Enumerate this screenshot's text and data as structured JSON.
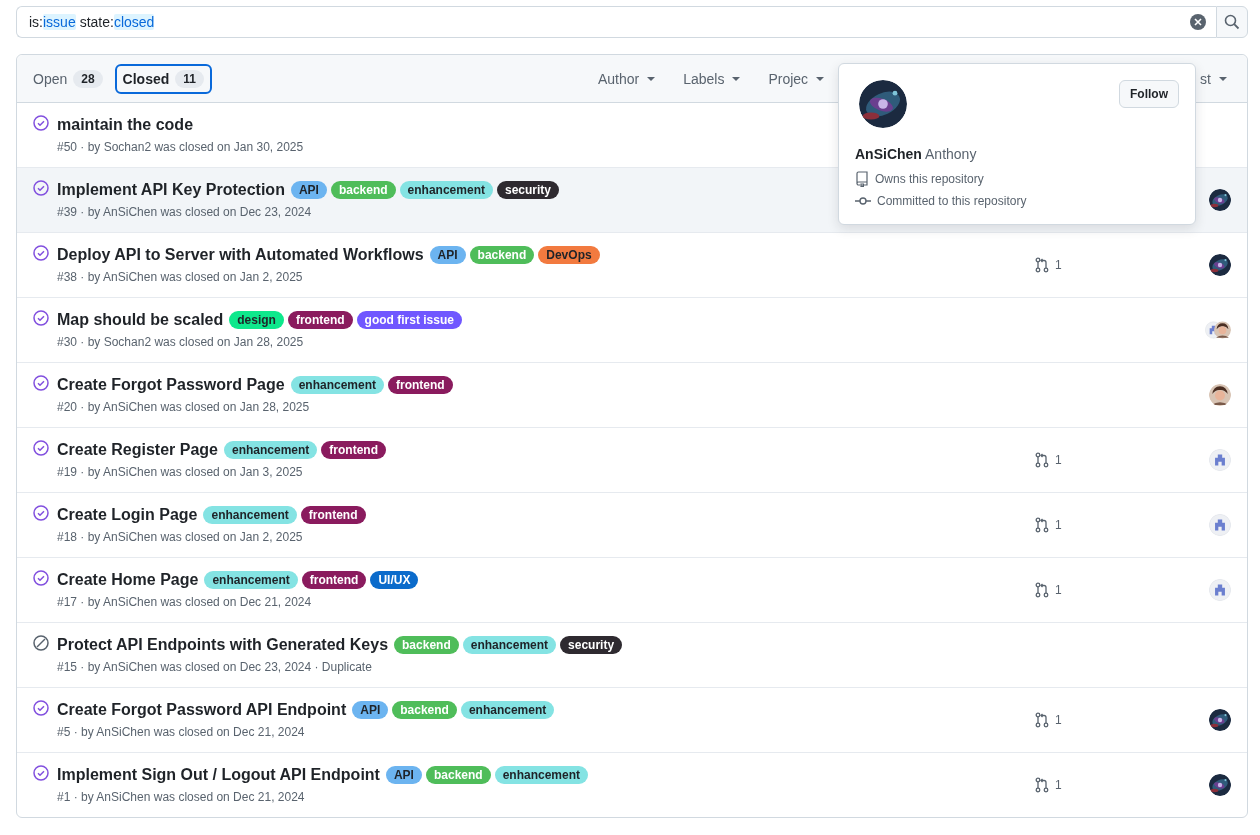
{
  "search": {
    "tokens": [
      {
        "text": "is:",
        "kind": "key"
      },
      {
        "text": "issue",
        "kind": "value"
      },
      {
        "text": "state:",
        "kind": "key"
      },
      {
        "text": "closed",
        "kind": "value"
      }
    ]
  },
  "tabs": [
    {
      "label": "Open",
      "count": "28",
      "selected": false
    },
    {
      "label": "Closed",
      "count": "11",
      "selected": true
    }
  ],
  "filters": [
    "Author",
    "Labels",
    "Projec"
  ],
  "sort": {
    "label": "st"
  },
  "issues": [
    {
      "title": "maintain the code",
      "kind": "completed",
      "meta": "#50 · by Sochan2 was closed on Jan 30, 2025",
      "highlighted": false
    },
    {
      "title": "Implement API Key Protection",
      "kind": "completed",
      "meta": "#39 · by AnSiChen was closed on Dec 23, 2024",
      "highlighted": true,
      "labels": [
        {
          "name": "API",
          "color": "#6cb4f0"
        },
        {
          "name": "backend",
          "color": "#4fbd5a"
        },
        {
          "name": "enhancement",
          "color": "#84e3e3"
        },
        {
          "name": "security",
          "color": "#2e2a30"
        }
      ],
      "avatars": [
        {
          "kind": "galaxy"
        }
      ]
    },
    {
      "title": "Deploy API to Server with Automated Workflows",
      "kind": "completed",
      "meta": "#38 · by AnSiChen was closed on Jan 2, 2025",
      "highlighted": false,
      "labels": [
        {
          "name": "API",
          "color": "#6cb4f0"
        },
        {
          "name": "backend",
          "color": "#4fbd5a"
        },
        {
          "name": "DevOps",
          "color": "#f27a3f"
        }
      ],
      "prs": "1",
      "avatars": [
        {
          "kind": "galaxy"
        }
      ]
    },
    {
      "title": "Map should be scaled",
      "kind": "completed",
      "meta": "#30 · by Sochan2 was closed on Jan 28, 2025",
      "highlighted": false,
      "labels": [
        {
          "name": "design",
          "color": "#0ee88c"
        },
        {
          "name": "frontend",
          "color": "#8a1b5e"
        },
        {
          "name": "good first issue",
          "color": "#7057ff"
        }
      ],
      "avatars": [
        {
          "kind": "identicon"
        },
        {
          "kind": "person"
        }
      ]
    },
    {
      "title": "Create Forgot Password Page",
      "kind": "completed",
      "meta": "#20 · by AnSiChen was closed on Jan 28, 2025",
      "highlighted": false,
      "labels": [
        {
          "name": "enhancement",
          "color": "#84e3e3"
        },
        {
          "name": "frontend",
          "color": "#8a1b5e"
        }
      ],
      "avatars": [
        {
          "kind": "person"
        }
      ]
    },
    {
      "title": "Create Register Page",
      "kind": "completed",
      "meta": "#19 · by AnSiChen was closed on Jan 3, 2025",
      "highlighted": false,
      "labels": [
        {
          "name": "enhancement",
          "color": "#84e3e3"
        },
        {
          "name": "frontend",
          "color": "#8a1b5e"
        }
      ],
      "prs": "1",
      "avatars": [
        {
          "kind": "identicon"
        }
      ]
    },
    {
      "title": "Create Login Page",
      "kind": "completed",
      "meta": "#18 · by AnSiChen was closed on Jan 2, 2025",
      "highlighted": false,
      "labels": [
        {
          "name": "enhancement",
          "color": "#84e3e3"
        },
        {
          "name": "frontend",
          "color": "#8a1b5e"
        }
      ],
      "prs": "1",
      "avatars": [
        {
          "kind": "identicon"
        }
      ]
    },
    {
      "title": "Create Home Page",
      "kind": "completed",
      "meta": "#17 · by AnSiChen was closed on Dec 21, 2024",
      "highlighted": false,
      "labels": [
        {
          "name": "enhancement",
          "color": "#84e3e3"
        },
        {
          "name": "frontend",
          "color": "#8a1b5e"
        },
        {
          "name": "UI/UX",
          "color": "#0b6bcb"
        }
      ],
      "prs": "1",
      "avatars": [
        {
          "kind": "identicon"
        }
      ]
    },
    {
      "title": "Protect API Endpoints with Generated Keys",
      "kind": "not_planned",
      "meta": "#15 · by AnSiChen was closed on Dec 23, 2024 · Duplicate",
      "highlighted": false,
      "labels": [
        {
          "name": "backend",
          "color": "#4fbd5a"
        },
        {
          "name": "enhancement",
          "color": "#84e3e3"
        },
        {
          "name": "security",
          "color": "#2e2a30"
        }
      ]
    },
    {
      "title": "Create Forgot Password API Endpoint",
      "kind": "completed",
      "meta": "#5 · by AnSiChen was closed on Dec 21, 2024",
      "highlighted": false,
      "labels": [
        {
          "name": "API",
          "color": "#6cb4f0"
        },
        {
          "name": "backend",
          "color": "#4fbd5a"
        },
        {
          "name": "enhancement",
          "color": "#84e3e3"
        }
      ],
      "prs": "1",
      "avatars": [
        {
          "kind": "galaxy"
        }
      ]
    },
    {
      "title": "Implement Sign Out / Logout API Endpoint",
      "kind": "completed",
      "meta": "#1 · by AnSiChen was closed on Dec 21, 2024",
      "highlighted": false,
      "labels": [
        {
          "name": "API",
          "color": "#6cb4f0"
        },
        {
          "name": "backend",
          "color": "#4fbd5a"
        },
        {
          "name": "enhancement",
          "color": "#84e3e3"
        }
      ],
      "prs": "1",
      "avatars": [
        {
          "kind": "galaxy"
        }
      ]
    }
  ],
  "hovercard": {
    "avatar": {
      "kind": "galaxy"
    },
    "login": "AnSiChen",
    "name": "Anthony",
    "button": "Follow",
    "facts": [
      {
        "kind": "repo",
        "text": "Owns this repository"
      },
      {
        "kind": "commit",
        "text": "Committed to this repository"
      }
    ]
  }
}
